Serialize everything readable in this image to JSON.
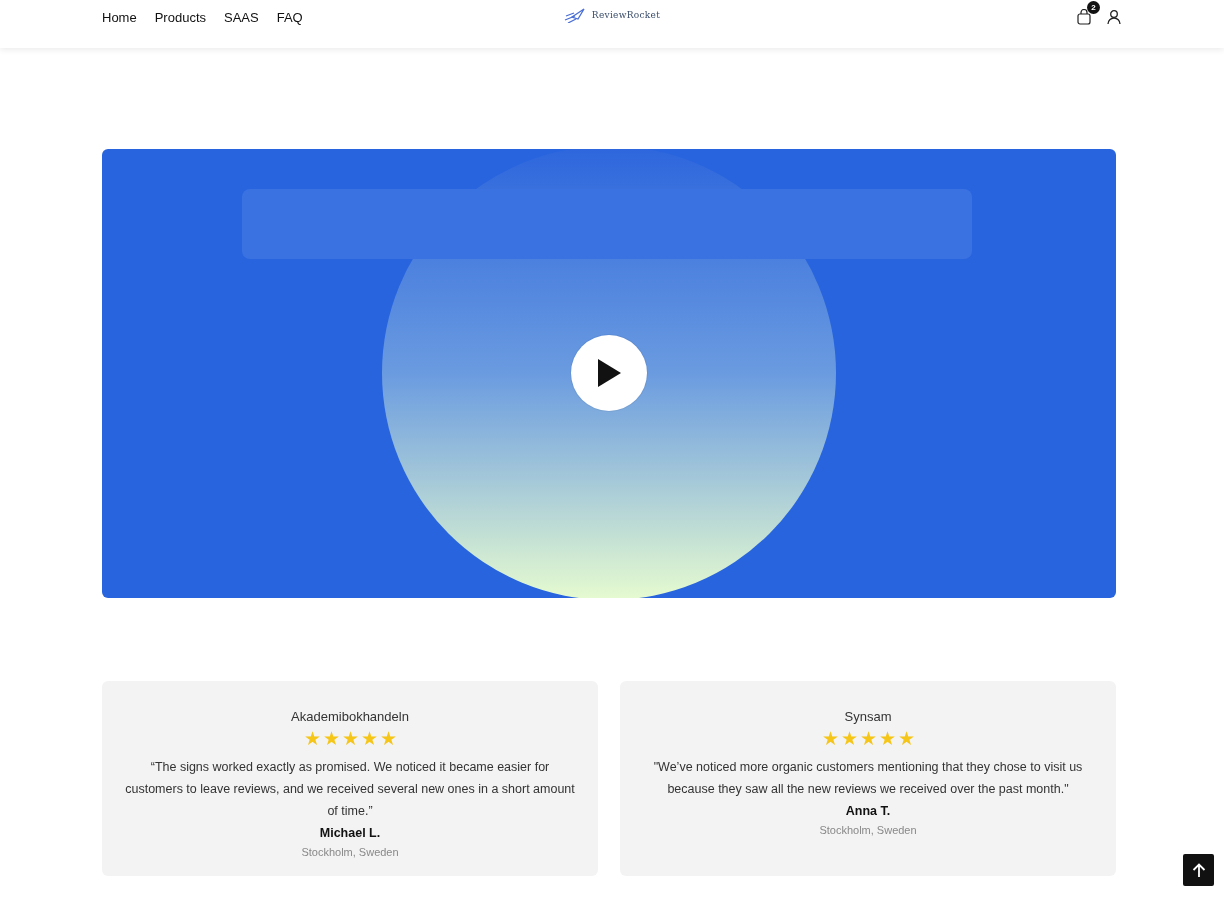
{
  "header": {
    "nav": [
      "Home",
      "Products",
      "SAAS",
      "FAQ"
    ],
    "logo": "ReviewRocket",
    "cart_count": "2"
  },
  "testimonials": [
    {
      "company": "Akademibokhandeln",
      "stars": 5,
      "quote": "“The signs worked exactly as promised. We noticed it became easier for customers to leave reviews, and we received several new ones in a short amount of time.”",
      "author": "Michael L.",
      "location": "Stockholm, Sweden"
    },
    {
      "company": "Synsam",
      "stars": 5,
      "quote": "\"We’ve noticed more organic customers mentioning that they chose to visit us because they saw all the new reviews we received over the past month.\"",
      "author": "Anna T.",
      "location": "Stockholm, Sweden"
    }
  ]
}
